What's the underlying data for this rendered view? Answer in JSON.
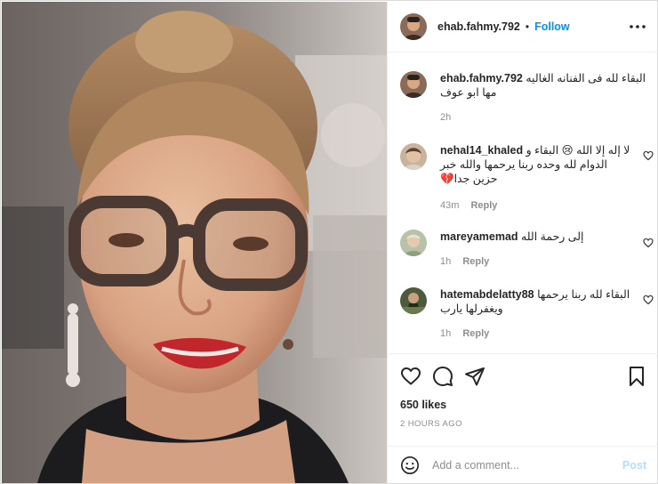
{
  "post": {
    "author": "ehab.fahmy.792",
    "separator": "•",
    "follow_label": "Follow",
    "more_icon": "more-horizontal-icon"
  },
  "caption": {
    "username": "ehab.fahmy.792",
    "text": "البقاء لله فى الفنانه الغاليه مها ابو عوف",
    "time": "2h"
  },
  "comments": [
    {
      "username": "nehal14_khaled",
      "text": "لا إله إلا الله 😢 البقاء و الدوام لله وحده ربنا يرحمها والله خبر حزين جدا💔",
      "time": "43m",
      "reply_label": "Reply"
    },
    {
      "username": "mareyamemad",
      "text": "إلى رحمة الله",
      "time": "1h",
      "reply_label": "Reply"
    },
    {
      "username": "hatemabdelatty88",
      "text": "البقاء لله ربنا يرحمها ويغفرلها يارب",
      "time": "1h",
      "reply_label": "Reply"
    }
  ],
  "engagement": {
    "likes": "650 likes",
    "posted_ago": "2 HOURS AGO",
    "icons": [
      "heart-icon",
      "comment-icon",
      "share-icon",
      "bookmark-icon"
    ]
  },
  "composer": {
    "placeholder": "Add a comment...",
    "value": "",
    "post_label": "Post"
  },
  "colors": {
    "accent": "#0095f6",
    "post_disabled": "#b2dffc",
    "muted_text": "#8e8e8e"
  }
}
